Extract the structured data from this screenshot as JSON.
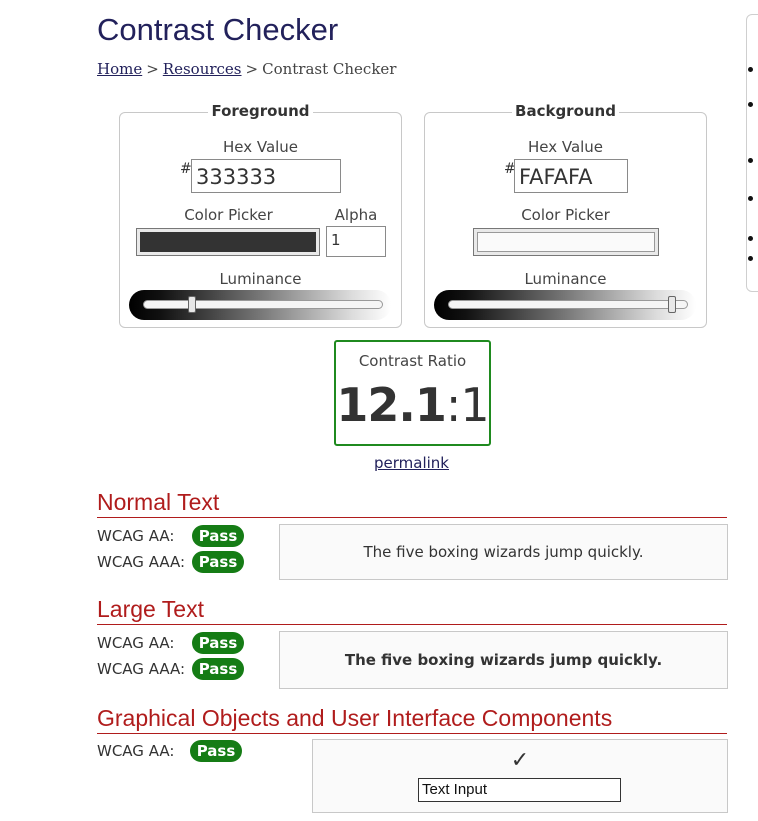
{
  "page": {
    "title": "Contrast Checker",
    "breadcrumb": [
      "Home",
      "Resources",
      "Contrast Checker"
    ],
    "breadcrumb_separator": ">"
  },
  "foreground": {
    "legend": "Foreground",
    "hex_label": "Hex Value",
    "hash": "#",
    "hex_value": "333333",
    "picker_label": "Color Picker",
    "alpha_label": "Alpha",
    "alpha_value": "1",
    "luminance_label": "Luminance",
    "color": "#333333",
    "luminance_level": 0.2
  },
  "background": {
    "legend": "Background",
    "hex_label": "Hex Value",
    "hash": "#",
    "hex_value": "FAFAFA",
    "picker_label": "Color Picker",
    "luminance_label": "Luminance",
    "color": "#FAFAFA",
    "luminance_level": 0.98
  },
  "contrast": {
    "label": "Contrast Ratio",
    "ratio_main": "12.1",
    "ratio_suffix": ":1",
    "permalink": "permalink"
  },
  "normal_text": {
    "heading": "Normal Text",
    "aa_label": "WCAG AA:",
    "aa_result": "Pass",
    "aaa_label": "WCAG AAA:",
    "aaa_result": "Pass",
    "sample": "The five boxing wizards jump quickly."
  },
  "large_text": {
    "heading": "Large Text",
    "aa_label": "WCAG AA:",
    "aa_result": "Pass",
    "aaa_label": "WCAG AAA:",
    "aaa_result": "Pass",
    "sample": "The five boxing wizards jump quickly."
  },
  "graphical": {
    "heading": "Graphical Objects and User Interface Components",
    "aa_label": "WCAG AA:",
    "aa_result": "Pass",
    "checkmark": "✓",
    "text_input_value": "Text Input"
  },
  "colors": {
    "title": "#22215b",
    "section_heading": "#b01c1c",
    "pass_badge": "#157c15",
    "ratio_border": "#1f8a1f"
  }
}
